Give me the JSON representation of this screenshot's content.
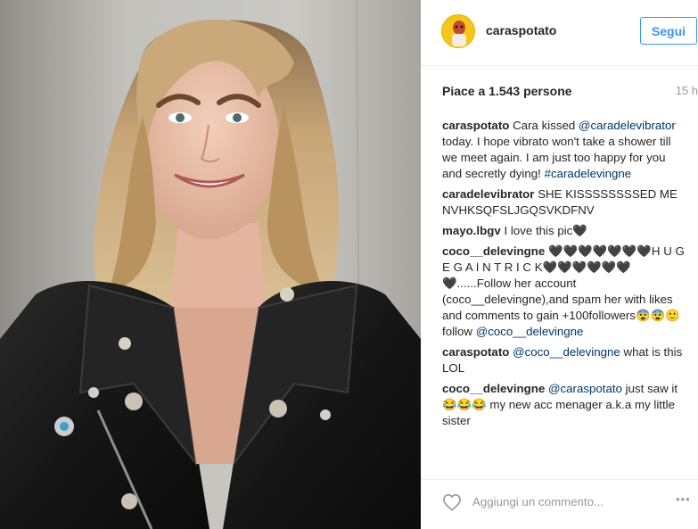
{
  "post": {
    "image_alt": "Photo of a smiling woman with shoulder-length blonde hair wearing a black leather jacket with silver pins"
  },
  "header": {
    "username": "caraspotato",
    "follow_label": "Segui"
  },
  "stats": {
    "likes_text": "Piace a 1.543 persone",
    "time_ago": "15 h"
  },
  "comments": [
    {
      "user": "caraspotato",
      "parts": [
        {
          "t": "text",
          "v": "Cara kissed "
        },
        {
          "t": "mention",
          "v": "@caradelevibrator"
        },
        {
          "t": "text",
          "v": " today. I hope vibrato won't take a shower till we meet again. I am just too happy for you and secretly dying! "
        },
        {
          "t": "mention",
          "v": "#caradelevingne"
        }
      ]
    },
    {
      "user": "caradelevibrator",
      "parts": [
        {
          "t": "text",
          "v": "SHE KISSSSSSSSED ME NVHKSQFSLJGQSVKDFNV"
        }
      ]
    },
    {
      "user": "mayo.lbgv",
      "parts": [
        {
          "t": "text",
          "v": "I love this pic🖤"
        }
      ]
    },
    {
      "user": "coco__delevingne",
      "parts": [
        {
          "t": "text",
          "v": "🖤🖤🖤🖤🖤🖤🖤H U G E G A I N T R I C K🖤🖤🖤🖤🖤🖤🖤......Follow her account (coco__delevingne),and spam her with likes and comments to gain +100followers😨😨🙂 follow "
        },
        {
          "t": "mention",
          "v": "@coco__delevingne"
        }
      ]
    },
    {
      "user": "caraspotato",
      "parts": [
        {
          "t": "mention",
          "v": "@coco__delevingne"
        },
        {
          "t": "text",
          "v": " what is this LOL"
        }
      ]
    },
    {
      "user": "coco__delevingne",
      "parts": [
        {
          "t": "mention",
          "v": "@caraspotato"
        },
        {
          "t": "text",
          "v": " just saw it😂😂😂 my new acc menager a.k.a my little sister"
        }
      ]
    }
  ],
  "footer": {
    "comment_placeholder": "Aggiungi un commento...",
    "more_label": "•••"
  },
  "colors": {
    "accent": "#3897f0",
    "mention": "#003569",
    "muted": "#999999"
  }
}
